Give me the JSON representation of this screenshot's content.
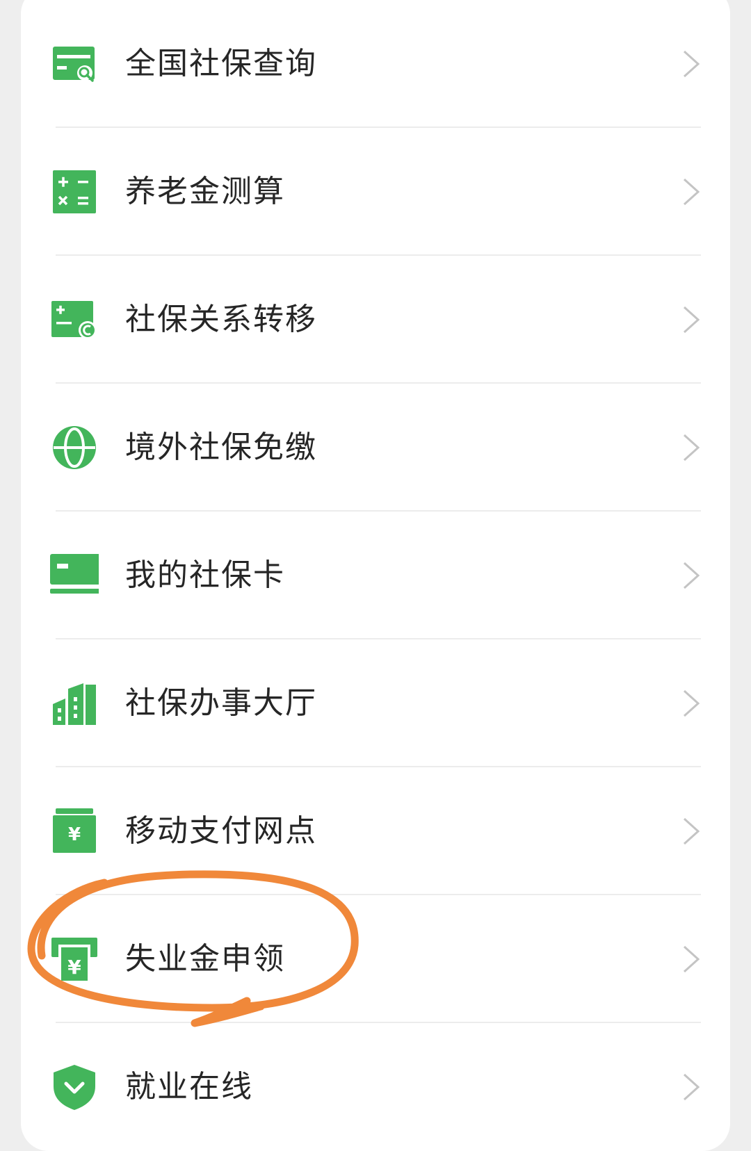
{
  "colors": {
    "accent": "#43b55b",
    "text": "#262626",
    "chevron": "#c4c4c4",
    "divider": "#ececec",
    "annotation": "#f0883a"
  },
  "menu": {
    "items": [
      {
        "label": "全国社保查询",
        "icon": "card-search-icon"
      },
      {
        "label": "养老金测算",
        "icon": "calculator-icon"
      },
      {
        "label": "社保关系转移",
        "icon": "transfer-icon"
      },
      {
        "label": "境外社保免缴",
        "icon": "globe-icon"
      },
      {
        "label": "我的社保卡",
        "icon": "card-icon"
      },
      {
        "label": "社保办事大厅",
        "icon": "building-icon"
      },
      {
        "label": "移动支付网点",
        "icon": "payment-icon"
      },
      {
        "label": "失业金申领",
        "icon": "atm-icon"
      },
      {
        "label": "就业在线",
        "icon": "shield-icon"
      }
    ]
  }
}
